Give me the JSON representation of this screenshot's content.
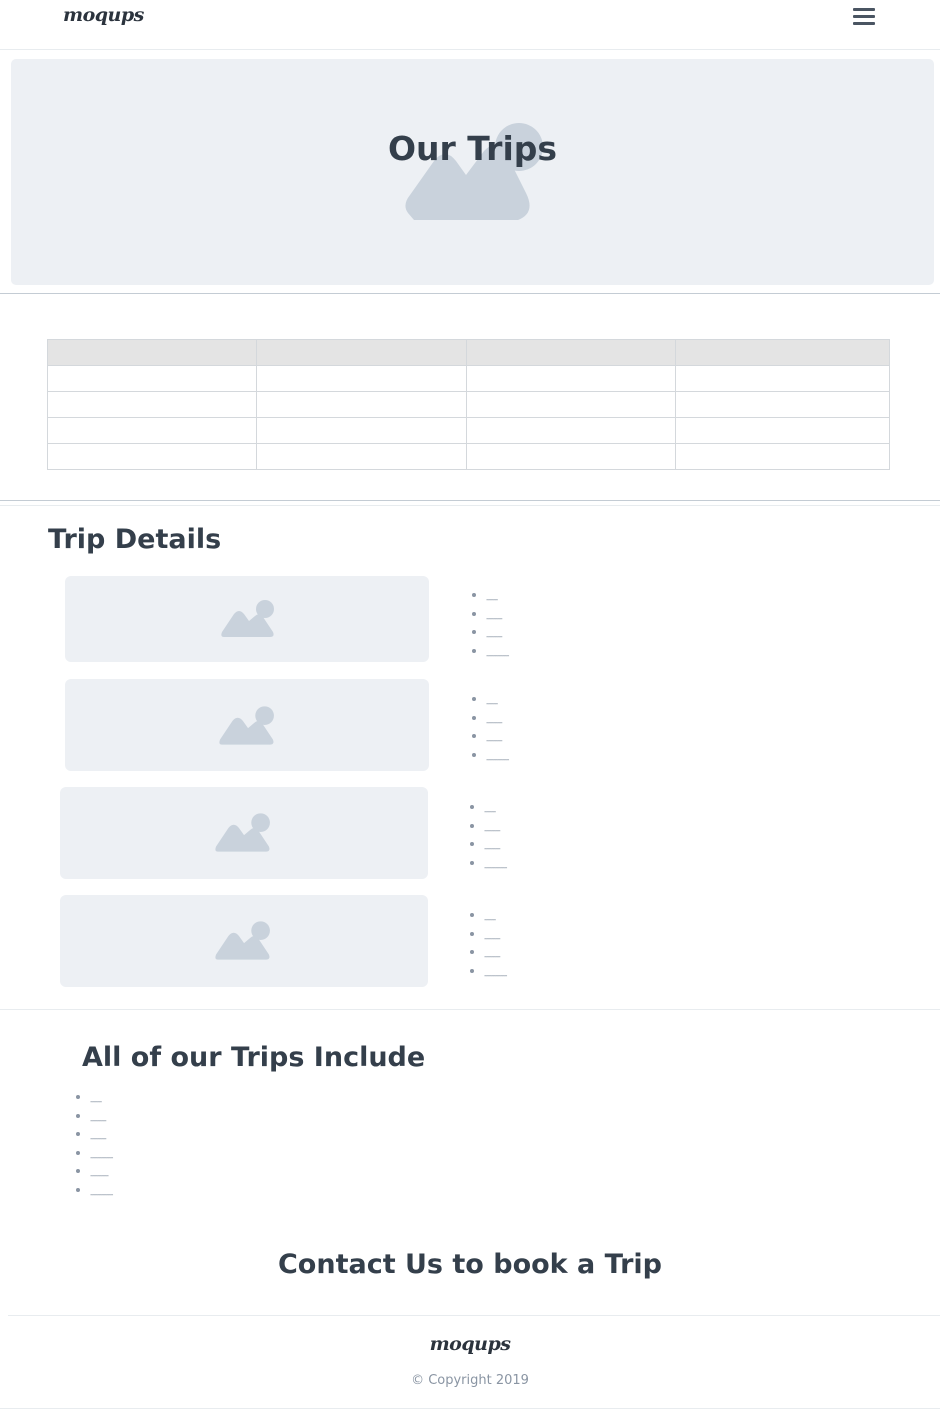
{
  "header": {
    "logo_text": "moqups",
    "menu_icon": "hamburger-menu-icon"
  },
  "hero": {
    "title": "Our Trips",
    "image_icon": "image-placeholder-icon"
  },
  "table": {
    "columns": 4,
    "body_rows": 4
  },
  "trip_details": {
    "heading": "Trip Details",
    "items": [
      {
        "image_icon": "image-placeholder-icon",
        "bullets": [
          "-----",
          "-------",
          "-------",
          "----------"
        ]
      },
      {
        "image_icon": "image-placeholder-icon",
        "bullets": [
          "-----",
          "-------",
          "-------",
          "----------"
        ]
      },
      {
        "image_icon": "image-placeholder-icon",
        "bullets": [
          "-----",
          "-------",
          "-------",
          "----------"
        ]
      },
      {
        "image_icon": "image-placeholder-icon",
        "bullets": [
          "-----",
          "-------",
          "-------",
          "----------"
        ]
      }
    ]
  },
  "includes": {
    "heading": "All of our Trips Include",
    "bullets": [
      "-----",
      "-------",
      "-------",
      "----------",
      "--------",
      "----------"
    ]
  },
  "contact": {
    "heading": "Contact Us to book a Trip"
  },
  "footer": {
    "logo_text": "moqups",
    "copyright": "© Copyright 2019"
  },
  "colors": {
    "placeholder_bg": "#edf0f4",
    "placeholder_icon": "#c9d2dc",
    "heading_text": "#343f4b",
    "muted_text": "#8a95a3"
  }
}
